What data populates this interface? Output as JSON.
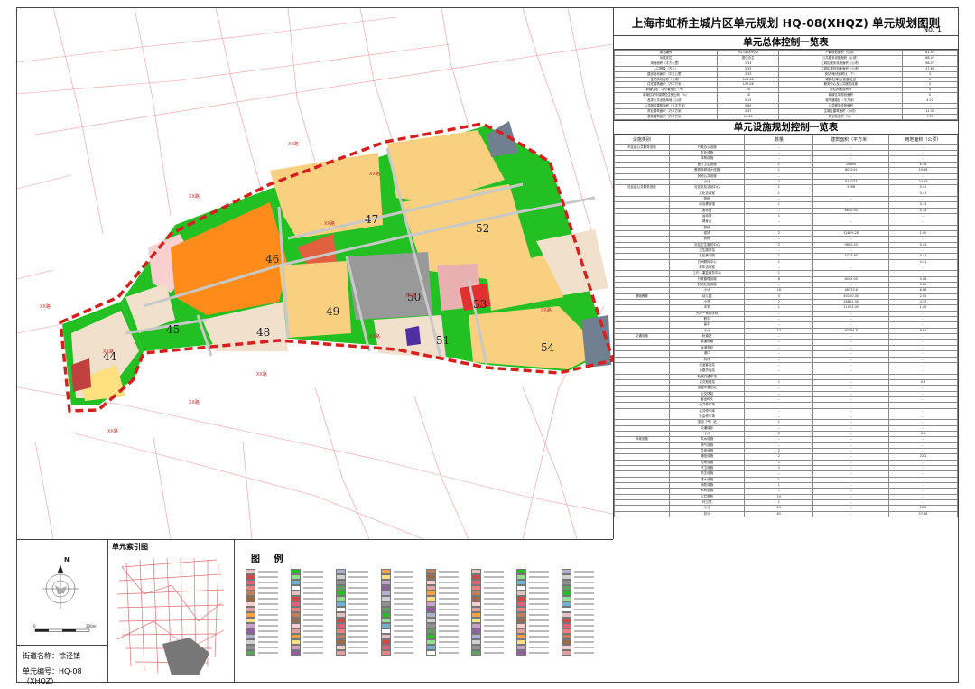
{
  "title": "上海市虹桥主城片区单元规划 HQ-08(XHQZ) 单元规划图则",
  "sheet_no": "No. 1",
  "sections": {
    "overall": "单元总体控制一览表",
    "facilities": "单元设施规划控制一览表",
    "legend": "图 例",
    "index_map": "单元索引图"
  },
  "street": {
    "name": "街道名称：徐泾镇",
    "code": "单元编号：HQ-08（XHQZ）"
  },
  "scale_label": "200m",
  "blocks": [
    "44",
    "45",
    "46",
    "47",
    "48",
    "49",
    "50",
    "51",
    "52",
    "53",
    "54"
  ],
  "road_label": "XX路",
  "overall_rows": [
    [
      "单元编号",
      "HQ-08(XHQZ)",
      "户籍规划面积（公顷）",
      "61.47"
    ],
    [
      "功能定位",
      "居住为主",
      "公共服务设施面积（公顷）",
      "68.07"
    ],
    [
      "用地面积（平方公里）",
      "3.33",
      "主城区服务设施面积（公顷）",
      "68.07"
    ],
    [
      "人口规模（万人）",
      "3.33",
      "主城区规划用地面积（公顷）",
      "37.69"
    ],
    [
      "建设用地面积（平方公里）",
      "3.33",
      "街坊/地块面积比（个）",
      "3"
    ],
    [
      "住宅用地面积（公顷）",
      "105.08",
      "城镇化/单元/街道/社区",
      "2"
    ],
    [
      "住宅建筑面积（万平方米）",
      "107.08",
      "服务中心及公共服务设施",
      "2"
    ],
    [
      "新增住宅、中小套型比（%）",
      "30",
      "居住用地容积率",
      "4"
    ],
    [
      "新增住宅中保障性住房比例（%）",
      "30",
      "新增住宅规划面积",
      "0"
    ],
    [
      "各类公共设施用地（公顷）",
      "4.13",
      "城市道路比（平方米）",
      "4.22"
    ],
    [
      "公共服务建筑面积（万平方米）",
      "3.89",
      "公共服务设施面积",
      "--"
    ],
    [
      "商业建筑面积（万平方米）",
      "3.47",
      "主城区建筑面积（公顷）",
      "11.33"
    ],
    [
      "基准建筑面积（万平方米）",
      "14.32",
      "规划总面积（%）",
      "7.33"
    ]
  ],
  "facility_header": [
    "设施类别",
    "",
    "数量",
    "建筑面积（平方米）",
    "用地面积（公顷）"
  ],
  "facility_rows": [
    [
      "市区级公共服务设施",
      "行政办公设施",
      "--",
      "--",
      "--"
    ],
    [
      "",
      "文化设施",
      "--",
      "--",
      "--"
    ],
    [
      "",
      "体育设施",
      "--",
      "--",
      "--"
    ],
    [
      "",
      "医疗卫生设施",
      "1",
      "28850",
      "6.36"
    ],
    [
      "",
      "教育科研设计设施",
      "1",
      "602241",
      "19.66"
    ],
    [
      "",
      "其他公共设施",
      "--",
      "--",
      "--"
    ],
    [
      "",
      "小计",
      "2",
      "813377",
      "24.19"
    ],
    [
      "社区级公共服务设施",
      "社区文化活动中心",
      "1",
      "5396",
      "0.41"
    ],
    [
      "",
      "文化活动室",
      "1",
      "",
      "0.41"
    ],
    [
      "",
      "其他",
      "--",
      "--",
      "--"
    ],
    [
      "",
      "综合健身馆",
      "1",
      "",
      "0.74"
    ],
    [
      "",
      "游泳馆",
      "--",
      "8820.00",
      "0.74"
    ],
    [
      "",
      "运动场",
      "1",
      "",
      "--"
    ],
    [
      "",
      "健身点",
      "--",
      "--",
      "--"
    ],
    [
      "",
      "其他",
      "--",
      "--",
      "--"
    ],
    [
      "",
      "菜场",
      "2",
      "12879.28",
      "1.00"
    ],
    [
      "",
      "其他",
      "--",
      "--",
      "--"
    ],
    [
      "",
      "社区卫生服务中心",
      "2",
      "9802.20",
      "0.44"
    ],
    [
      "",
      "卫生服务站",
      "--",
      "--",
      "--"
    ],
    [
      "",
      "社区养老院",
      "1",
      "5777.60",
      "0.41"
    ],
    [
      "",
      "日间照料中心",
      "1",
      "",
      "0.41"
    ],
    [
      "",
      "老年活动室",
      "--",
      "--",
      "--"
    ],
    [
      "",
      "工疗、康复服务中心",
      "1",
      "",
      "--"
    ],
    [
      "",
      "行政管理设施",
      "8",
      "8092.00",
      "0.08"
    ],
    [
      "",
      "其他社区设施",
      "--",
      "--",
      "0.66"
    ],
    [
      "",
      "小计",
      "18",
      "48133.6",
      "6.88"
    ],
    [
      "基础教育",
      "幼儿园",
      "3",
      "40120.00",
      "2.00"
    ],
    [
      "",
      "小学",
      "2",
      "26881.00",
      "4.13"
    ],
    [
      "",
      "中学",
      "1",
      "11013.00",
      "1.09"
    ],
    [
      "",
      "九年一贯制学校",
      "--",
      "--",
      "--"
    ],
    [
      "",
      "职中",
      "--",
      "--",
      "--"
    ],
    [
      "",
      "高中",
      "--",
      "--",
      "--"
    ],
    [
      "",
      "小计",
      "12",
      "93264.8",
      "6.81"
    ],
    [
      "交通设施",
      "轨道站",
      "--",
      "--",
      "--"
    ],
    [
      "",
      "轨道线路",
      "--",
      "--",
      "--"
    ],
    [
      "",
      "轨道车站",
      "--",
      "--",
      "--"
    ],
    [
      "",
      "港口",
      "--",
      "--",
      "--"
    ],
    [
      "",
      "机场",
      "--",
      "--",
      "--"
    ],
    [
      "",
      "长途客运站",
      "--",
      "--",
      "--"
    ],
    [
      "",
      "公路货运站",
      "--",
      "--",
      "--"
    ],
    [
      "",
      "轨道交通车站",
      "--",
      "--",
      "--"
    ],
    [
      "",
      "公交枢纽站",
      "1",
      "--",
      "0.6"
    ],
    [
      "",
      "出租车营业站",
      "--",
      "--",
      "--"
    ],
    [
      "",
      "公交场站",
      "--",
      "--",
      "--"
    ],
    [
      "",
      "客运码头",
      "--",
      "--",
      "--"
    ],
    [
      "",
      "公共停车场",
      "--",
      "--",
      "--"
    ],
    [
      "",
      "公共停车库",
      "--",
      "--",
      "--"
    ],
    [
      "",
      "社会停车场",
      "--",
      "--",
      "--"
    ],
    [
      "",
      "加油（气）站",
      "1",
      "--",
      "--"
    ],
    [
      "",
      "交通绿化",
      "--",
      "--",
      "--"
    ],
    [
      "",
      "小计",
      "2",
      "--",
      "0.6"
    ],
    [
      "市政设施",
      "供水设施",
      "--",
      "--",
      "--"
    ],
    [
      "",
      "燃气设施",
      "--",
      "--",
      "--"
    ],
    [
      "",
      "供电设施",
      "2",
      "--",
      "--"
    ],
    [
      "",
      "通信设施",
      "2",
      "--",
      "23.2"
    ],
    [
      "",
      "污水设施",
      "1",
      "--",
      "--"
    ],
    [
      "",
      "环卫设施",
      "2",
      "--",
      "--"
    ],
    [
      "",
      "防灾设施",
      "--",
      "--",
      "--"
    ],
    [
      "",
      "排水设施",
      "1",
      "--",
      "--"
    ],
    [
      "",
      "消防设施",
      "1",
      "--",
      "--"
    ],
    [
      "",
      "水利设施",
      "--",
      "--",
      "--"
    ],
    [
      "",
      "公共厕所",
      "10",
      "--",
      "--"
    ],
    [
      "",
      "环卫站",
      "1",
      "--",
      "--"
    ],
    [
      "",
      "小计",
      "19",
      "--",
      "23.2"
    ],
    [
      "",
      "总计",
      "61",
      "--",
      "57.68"
    ]
  ],
  "legend_items": [
    {
      "color": "#e8c0c0"
    },
    {
      "color": "#d04848"
    },
    {
      "color": "#e0607a"
    },
    {
      "color": "#f08080"
    },
    {
      "color": "#c08060"
    },
    {
      "color": "#9a6a4a"
    },
    {
      "color": "#f8d0d0"
    },
    {
      "color": "#e0a0a0"
    },
    {
      "color": "#ffa040"
    },
    {
      "color": "#ffe080"
    },
    {
      "color": "#c8a0c8"
    },
    {
      "color": "#9060a0"
    },
    {
      "color": "#b0b0d0"
    },
    {
      "color": "#d0d0d0"
    },
    {
      "color": "#909090"
    },
    {
      "color": "#60a060"
    },
    {
      "color": "#22c022"
    },
    {
      "color": "#90e090"
    },
    {
      "color": "#70b0d0"
    },
    {
      "color": "#ffffff"
    }
  ]
}
